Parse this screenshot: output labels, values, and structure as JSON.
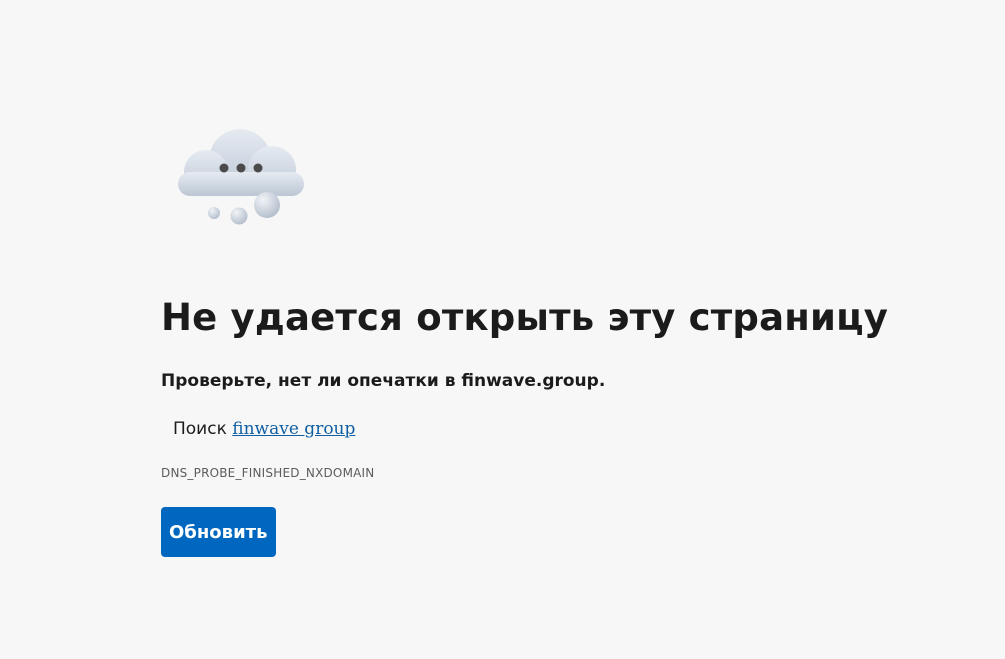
{
  "illustration": {
    "icon": "cloud-dots-icon"
  },
  "error": {
    "title": "Не удается открыть эту страницу",
    "subtitle": "Проверьте, нет ли опечатки в finwave.group.",
    "search_prefix": "Поиск",
    "search_link": "finwave group",
    "code": "DNS_PROBE_FINISHED_NXDOMAIN",
    "refresh_label": "Обновить"
  },
  "colors": {
    "background": "#f7f7f7",
    "accent": "#0067c0",
    "link": "#0f5ea3"
  }
}
